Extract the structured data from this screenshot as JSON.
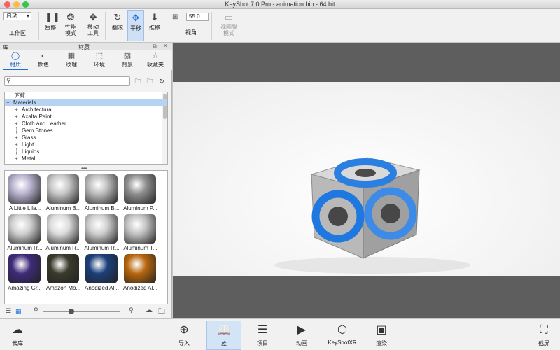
{
  "window": {
    "title": "KeyShot 7.0 Pro  - animation.bip  - 64 bit"
  },
  "toolbar": {
    "workspace_select": "启动",
    "workspace_label": "工作区",
    "pause": "暂停",
    "performance": "性能\n模式",
    "move_tool": "移动\n工具",
    "tumble": "翻滚",
    "pan": "平移",
    "dolly": "推移",
    "fov_value": "55.0",
    "fov_label": "视角",
    "viewnet": "视网膜\n模式"
  },
  "library": {
    "panel_title": "库",
    "header_title": "材质",
    "tabs": [
      {
        "label": "材质",
        "icon": "material-icon"
      },
      {
        "label": "颜色",
        "icon": "color-icon"
      },
      {
        "label": "纹理",
        "icon": "texture-icon"
      },
      {
        "label": "环境",
        "icon": "environment-icon"
      },
      {
        "label": "背景",
        "icon": "background-icon"
      },
      {
        "label": "收藏夹",
        "icon": "favorites-icon"
      }
    ],
    "search_placeholder": "",
    "tree": [
      {
        "label": "下载",
        "indent": 0,
        "prefix": "",
        "italic": true
      },
      {
        "label": "Materials",
        "indent": 0,
        "prefix": "−",
        "selected": true
      },
      {
        "label": "Architectural",
        "indent": 1,
        "prefix": "+"
      },
      {
        "label": "Axalta Paint",
        "indent": 1,
        "prefix": "+"
      },
      {
        "label": "Cloth and Leather",
        "indent": 1,
        "prefix": "+"
      },
      {
        "label": "Gem Stones",
        "indent": 1,
        "prefix": ""
      },
      {
        "label": "Glass",
        "indent": 1,
        "prefix": "+"
      },
      {
        "label": "Light",
        "indent": 1,
        "prefix": "+"
      },
      {
        "label": "Liquids",
        "indent": 1,
        "prefix": ""
      },
      {
        "label": "Metal",
        "indent": 1,
        "prefix": "+"
      }
    ],
    "thumbnails": [
      {
        "label": "A Little Lila...",
        "color": "#b9b3cf"
      },
      {
        "label": "Aluminum B...",
        "color": "#c7c7c7"
      },
      {
        "label": "Aluminum B...",
        "color": "#bdbdbd"
      },
      {
        "label": "Aluminum P...",
        "color": "#8f8f8f"
      },
      {
        "label": "Aluminum R...",
        "color": "#d0d0d0"
      },
      {
        "label": "Aluminum R...",
        "color": "#dcdcdc"
      },
      {
        "label": "Aluminum R...",
        "color": "#cfcfcf"
      },
      {
        "label": "Aluminum T...",
        "color": "#c3c3c3"
      },
      {
        "label": "Amazing Gr...",
        "color": "#3e2a7a"
      },
      {
        "label": "Amazon Mo...",
        "color": "#3a3a2c"
      },
      {
        "label": "Anodized Al...",
        "color": "#1c3f7a"
      },
      {
        "label": "Anodized Al...",
        "color": "#b8670d"
      }
    ]
  },
  "bottombar": {
    "cloud": "云库",
    "import": "导入",
    "library": "库",
    "project": "项目",
    "animation": "动画",
    "keyshotxr": "KeyShotXR",
    "render": "渲染",
    "screenshot": "截屏"
  }
}
